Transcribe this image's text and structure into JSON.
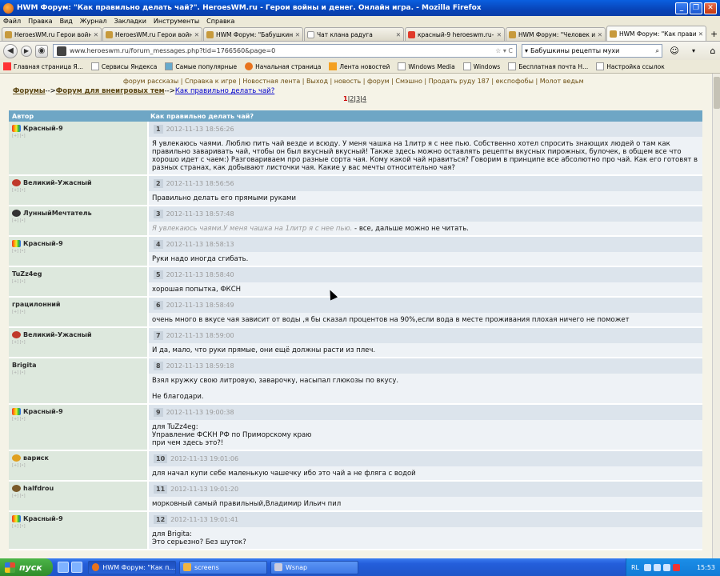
{
  "window": {
    "title": "HWM Форум: \"Как правильно делать чай?\". HeroesWM.ru - Герои войны и денег. Онлайн игра. - Mozilla Firefox"
  },
  "menu": [
    "Файл",
    "Правка",
    "Вид",
    "Журнал",
    "Закладки",
    "Инструменты",
    "Справка"
  ],
  "tabs": [
    {
      "label": "HeroesWM.ru Герои войн..."
    },
    {
      "label": "HeroesWM.ru Герои войн..."
    },
    {
      "label": "HWM Форум: \"Бабушкин..."
    },
    {
      "label": "Чат клана радуга"
    },
    {
      "label": "красный-9 heroeswm.ru-..."
    },
    {
      "label": "HWM Форум: \"Человек и..."
    },
    {
      "label": "HWM Форум: \"Как прави..."
    }
  ],
  "address": {
    "url": "www.heroeswm.ru/forum_messages.php?tid=1766560&page=0"
  },
  "search": {
    "value": "Бабушкины рецепты мухи"
  },
  "bookmarks": [
    "Главная страница Я...",
    "Сервисы Яндекса",
    "Самые популярные",
    "Начальная страница",
    "Лента новостей",
    "Windows Media",
    "Windows",
    "Бесплатная почта Н...",
    "Настройка ссылок"
  ],
  "page": {
    "top_links": "форум рассказы | Справка к игре | Новостная лента | Выход | новость | форум | Смэшно | Продать руду 187 | експофобы | Молот ведьм",
    "crumb1": "Форумы",
    "crumb_sep": "-->",
    "crumb2": "Форум для внеигровых тем",
    "crumb3": "Как правильно делать чай?",
    "pages": {
      "current": "1",
      "others": [
        "2",
        "3",
        "4"
      ]
    },
    "col_author": "Автор",
    "col_topic": "Как правильно делать чай?",
    "posts": [
      {
        "author": "Красный-9",
        "n": "1",
        "time": "2012-11-13 18:56:26",
        "text": "Я увлекаюсь чаями. Люблю пить чай везде и всюду. У меня чашка на 1литр я с нее пью. Собственно хотел спросить знающих людей о там как правильно заваривать чай, чтобы он был вкусный вкусный! Также здесь можно оставлять рецепты вкусных пирожных, булочек, в общем все что хорошо идет с чаем:) Разговариваем про разные сорта чая. Кому какой чай нравиться? Говорим в принципе все абсолютно про чай. Как его готовят в разных странах, как добывают листочки чая. Какие у вас мечты относительно чая?",
        "color": "rainbow"
      },
      {
        "author": "Великий-Ужасный",
        "n": "2",
        "time": "2012-11-13 18:56:56",
        "text": "Правильно делать его прямыми руками",
        "color": "#c0392b"
      },
      {
        "author": "ЛунныйМечтатель",
        "n": "3",
        "time": "2012-11-13 18:57:48",
        "quote": "Я увлекаюсь чаями.У меня чашка на 1литр я с нее пью.",
        "text": " - все, дальше можно не читать.",
        "color": "#333"
      },
      {
        "author": "Красный-9",
        "n": "4",
        "time": "2012-11-13 18:58:13",
        "text": "Руки надо иногда сгибать.",
        "color": "rainbow"
      },
      {
        "author": "TuZz4eg",
        "n": "5",
        "time": "2012-11-13 18:58:40",
        "text": "хорошая попытка, ФКСН",
        "color": ""
      },
      {
        "author": "грацилонний",
        "n": "6",
        "time": "2012-11-13 18:58:49",
        "text": "очень много в вкусе чая зависит от воды ,я бы сказал процентов на 90%,если вода в месте проживания плохая ничего не поможет",
        "color": ""
      },
      {
        "author": "Великий-Ужасный",
        "n": "7",
        "time": "2012-11-13 18:59:00",
        "text": "И да, мало, что руки прямые, они ещё должны расти из плеч.",
        "color": "#c0392b"
      },
      {
        "author": "Brigita",
        "n": "8",
        "time": "2012-11-13 18:59:18",
        "text": "Взял кружку свою литровую, заварочку, насыпал глюкозы по вкусу.\n\nНе благодари.",
        "color": ""
      },
      {
        "author": "Красный-9",
        "n": "9",
        "time": "2012-11-13 19:00:38",
        "text": "для TuZz4eg:\nУправление ФСКН РФ по Приморскому краю\nпри чем здесь это?!",
        "color": "rainbow"
      },
      {
        "author": "вариск",
        "n": "10",
        "time": "2012-11-13 19:01:06",
        "text": "для начал купи себе маленькую чашечку ибо это чай а не фляга с водой",
        "color": "#e0a020"
      },
      {
        "author": "halfdrou",
        "n": "11",
        "time": "2012-11-13 19:01:20",
        "text": "морковный самый правильный,Владимир Ильич пил",
        "color": "#7a5a2a"
      },
      {
        "author": "Красный-9",
        "n": "12",
        "time": "2012-11-13 19:01:41",
        "text": "для Brigita:\nЭто серьезно? Без шуток?",
        "color": "rainbow"
      }
    ]
  },
  "taskbar": {
    "start": "пуск",
    "items": [
      "HWM Форум: \"Как п...",
      "screens",
      "Wsnap"
    ],
    "lang": "RL",
    "clock": "15:53"
  }
}
